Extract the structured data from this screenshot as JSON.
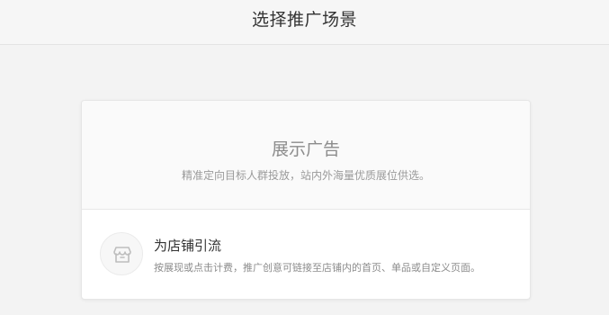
{
  "header": {
    "title": "选择推广场景"
  },
  "card": {
    "title": "展示广告",
    "subtitle": "精准定向目标人群投放，站内外海量优质展位供选。",
    "option": {
      "icon": "store-icon",
      "title": "为店铺引流",
      "description": "按展现或点击计费，推广创意可链接至店铺内的首页、单品或自定义页面。"
    }
  },
  "colors": {
    "page_bg": "#f3f3f3",
    "card_bg": "#ffffff",
    "title_text": "#333333",
    "muted_text": "#8c8c8c"
  }
}
